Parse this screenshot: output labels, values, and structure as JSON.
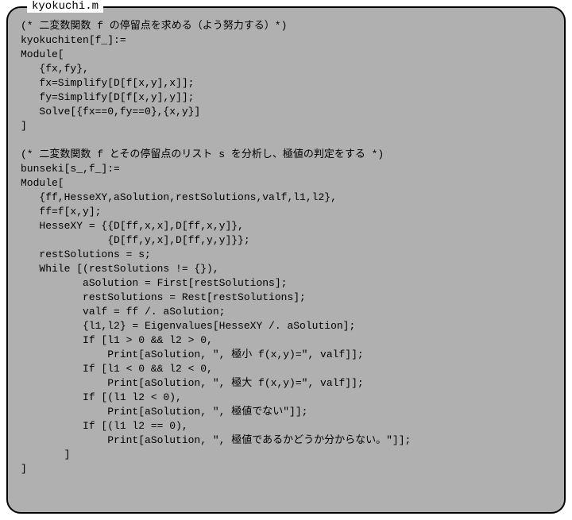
{
  "filename": "kyokuchi.m",
  "lines": [
    "(* 二変数関数 f の停留点を求める（よう努力する）*)",
    "kyokuchiten[f_]:=",
    "Module[",
    "   {fx,fy},",
    "   fx=Simplify[D[f[x,y],x]];",
    "   fy=Simplify[D[f[x,y],y]];",
    "   Solve[{fx==0,fy==0},{x,y}]",
    "]",
    "",
    "(* 二変数関数 f とその停留点のリスト s を分析し、極値の判定をする *)",
    "bunseki[s_,f_]:=",
    "Module[",
    "   {ff,HesseXY,aSolution,restSolutions,valf,l1,l2},",
    "   ff=f[x,y];",
    "   HesseXY = {{D[ff,x,x],D[ff,x,y]},",
    "              {D[ff,y,x],D[ff,y,y]}};",
    "   restSolutions = s;",
    "   While [(restSolutions != {}),",
    "          aSolution = First[restSolutions];",
    "          restSolutions = Rest[restSolutions];",
    "          valf = ff /. aSolution;",
    "          {l1,l2} = Eigenvalues[HesseXY /. aSolution];",
    "          If [l1 > 0 && l2 > 0,",
    "              Print[aSolution, \", 極小 f(x,y)=\", valf]];",
    "          If [l1 < 0 && l2 < 0,",
    "              Print[aSolution, \", 極大 f(x,y)=\", valf]];",
    "          If [(l1 l2 < 0),",
    "              Print[aSolution, \", 極値でない\"]];",
    "          If [(l1 l2 == 0),",
    "              Print[aSolution, \", 極値であるかどうか分からない。\"]];",
    "       ]",
    "]"
  ]
}
